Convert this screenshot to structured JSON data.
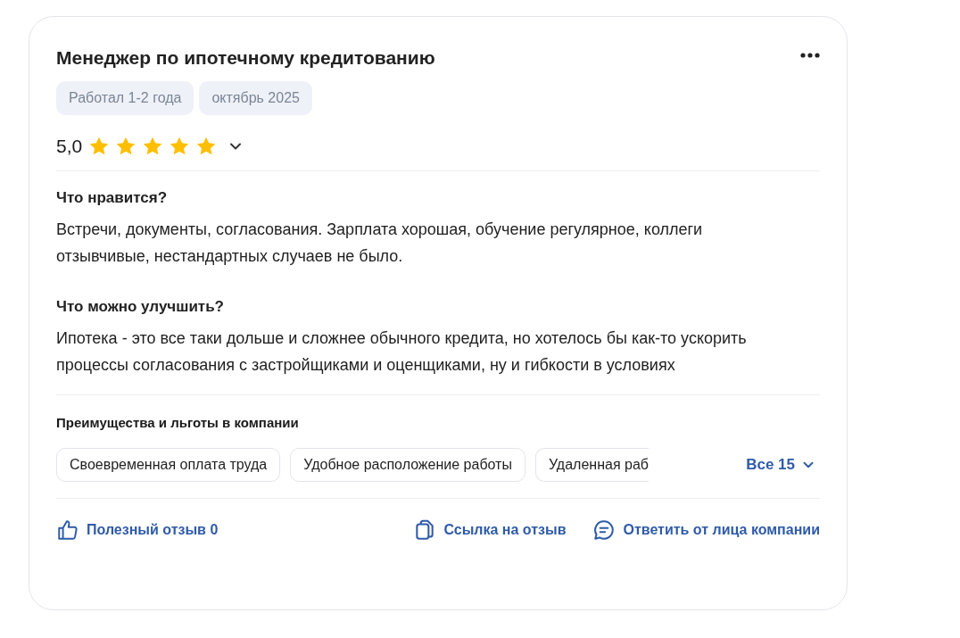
{
  "review": {
    "title": "Менеджер по ипотечному кредитованию",
    "tags": [
      "Работал 1-2 года",
      "октябрь 2025"
    ],
    "rating": "5,0",
    "stars": 5,
    "sections": [
      {
        "heading": "Что нравится?",
        "text": "Встречи, документы, согласования. Зарплата хорошая, обучение регулярное, коллеги отзывчивые, нестандартных случаев не было."
      },
      {
        "heading": "Что можно улучшить?",
        "text": "Ипотека - это все таки дольше и сложнее обычного кредита, но хотелось бы как-то ускорить процессы согласования с застройщиками и оценщиками, ну и гибкости в условиях"
      }
    ],
    "benefits": {
      "heading": "Преимущества и льготы в компании",
      "items": [
        "Своевременная оплата труда",
        "Удобное расположение работы",
        "Удаленная раб"
      ],
      "more": "Все 15"
    },
    "actions": [
      {
        "kind": "like",
        "label": "Полезный отзыв 0"
      },
      {
        "kind": "link",
        "label": "Ссылка на отзыв"
      },
      {
        "kind": "reply",
        "label": "Ответить от лица компании"
      }
    ]
  }
}
